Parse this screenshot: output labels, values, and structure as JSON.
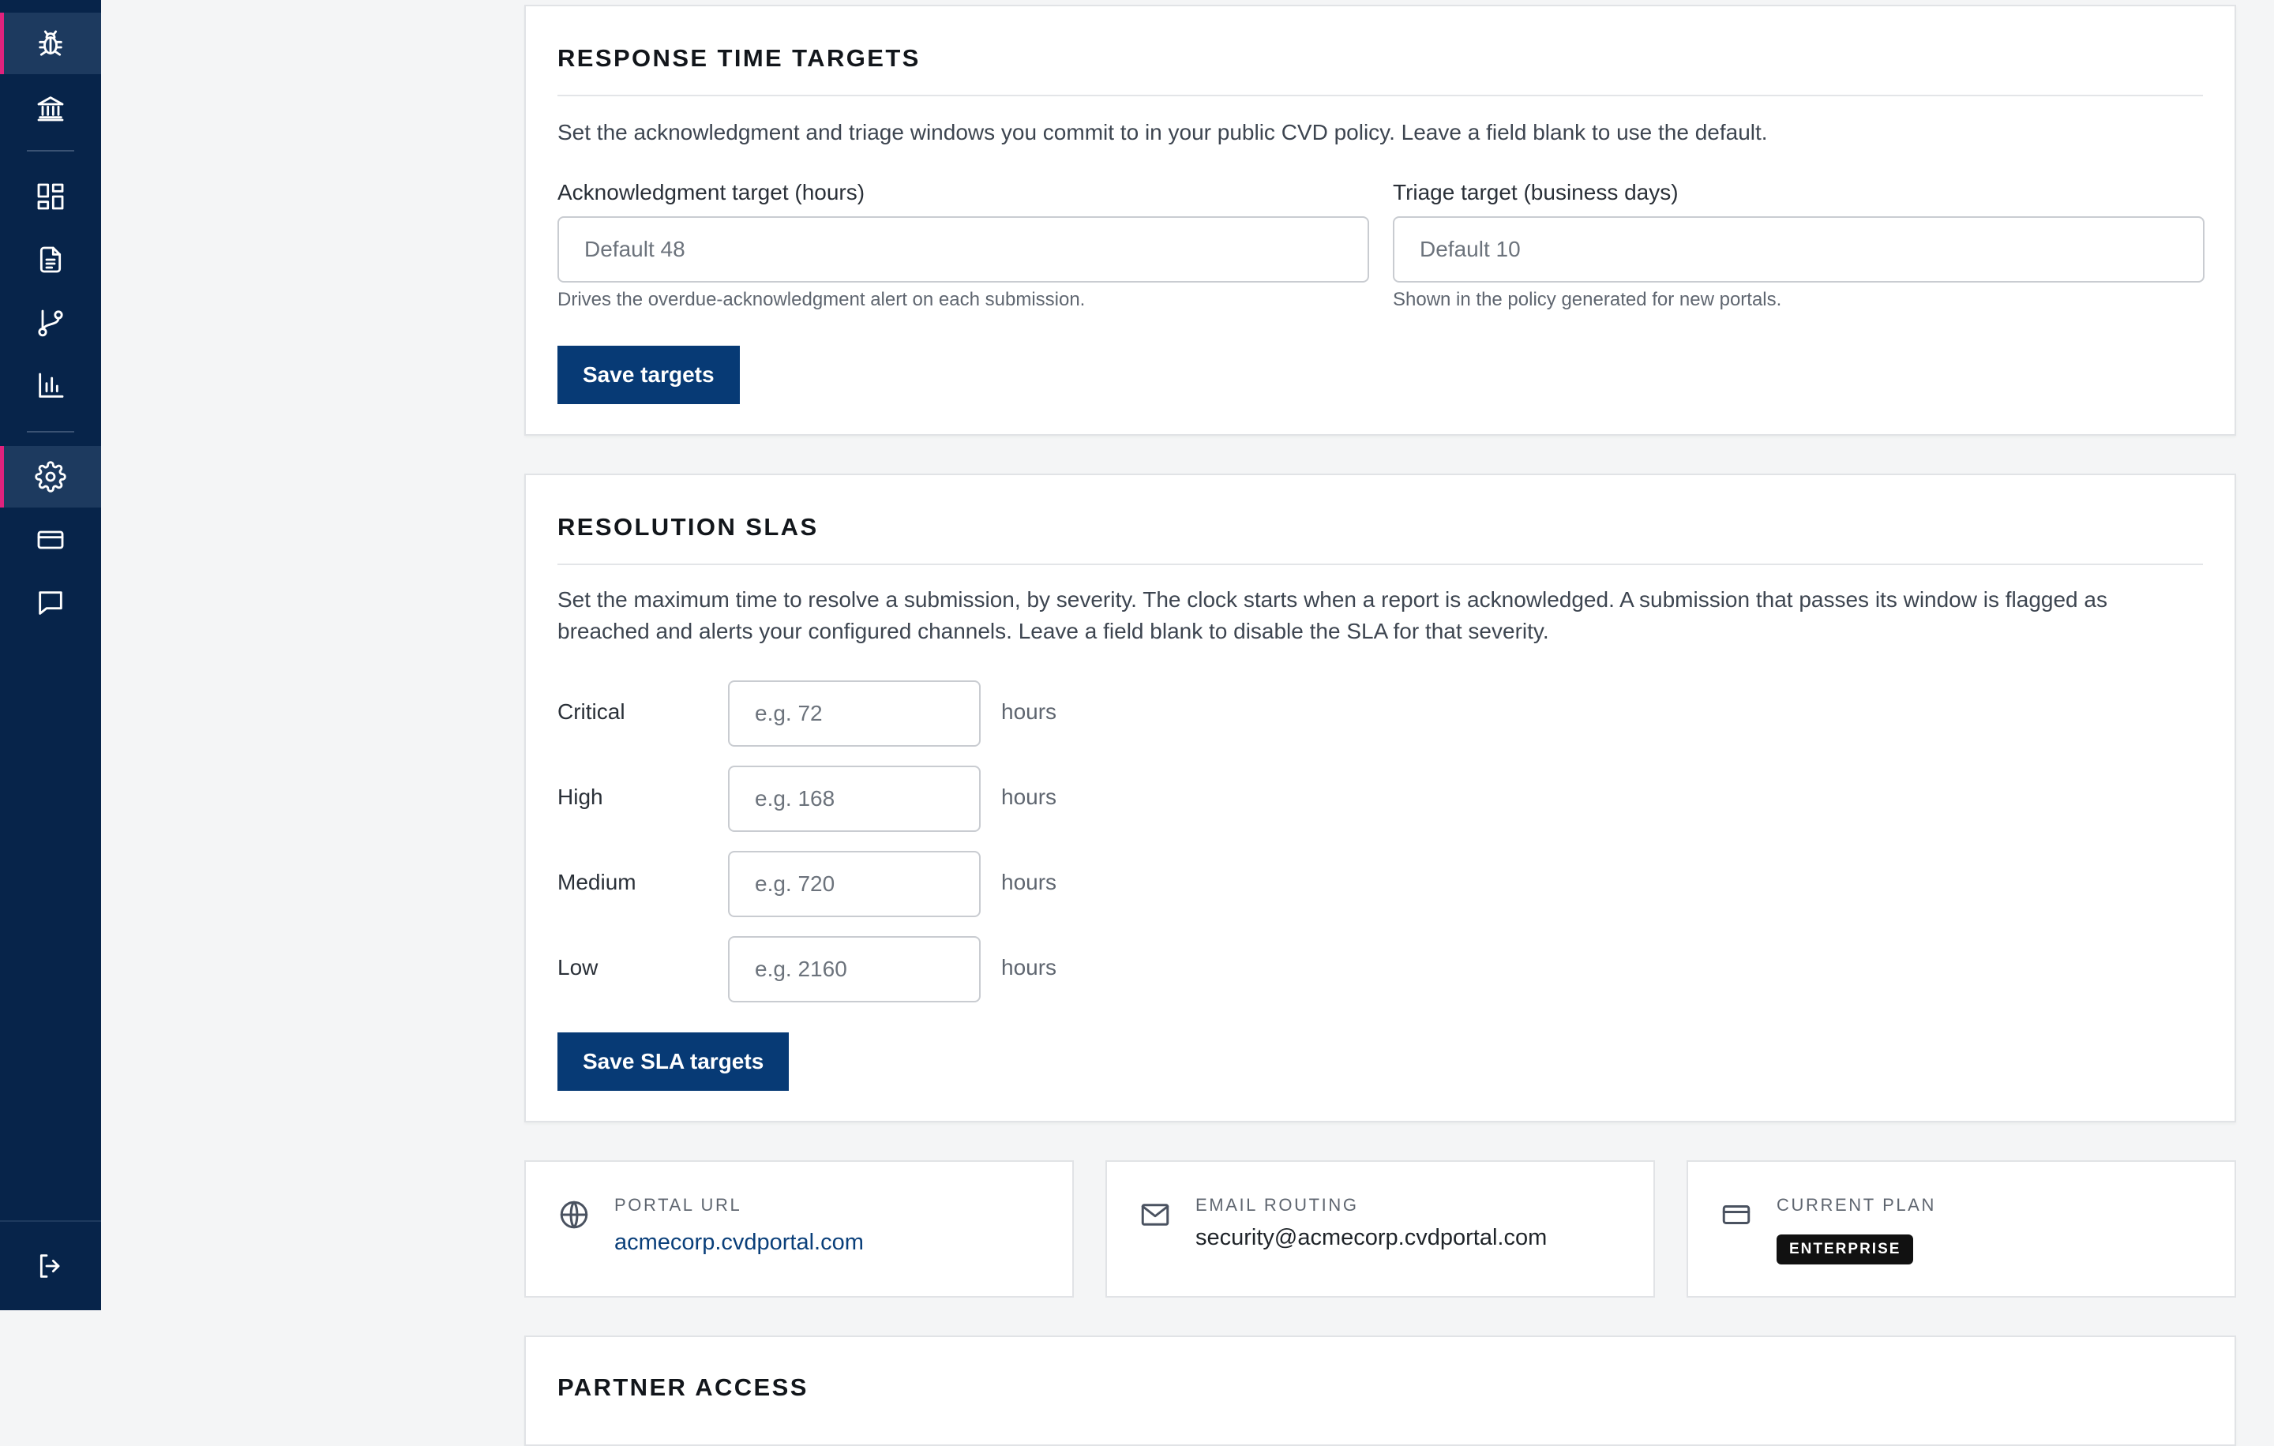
{
  "sidebar": {
    "items": [
      {
        "icon": "bug-icon",
        "active": true
      },
      {
        "icon": "bank-icon",
        "active": false
      },
      {
        "icon": "dashboard-icon",
        "active": false
      },
      {
        "icon": "document-icon",
        "active": false
      },
      {
        "icon": "git-branch-icon",
        "active": false
      },
      {
        "icon": "bar-chart-icon",
        "active": false
      },
      {
        "icon": "gear-icon",
        "active": true
      },
      {
        "icon": "credit-card-icon",
        "active": false
      },
      {
        "icon": "chat-icon",
        "active": false
      },
      {
        "icon": "logout-icon",
        "active": false
      }
    ]
  },
  "response_targets": {
    "title": "RESPONSE TIME TARGETS",
    "description": "Set the acknowledgment and triage windows you commit to in your public CVD policy. Leave a field blank to use the default.",
    "ack_label": "Acknowledgment target (hours)",
    "ack_placeholder": "Default 48",
    "ack_help": "Drives the overdue-acknowledgment alert on each submission.",
    "triage_label": "Triage target (business days)",
    "triage_placeholder": "Default 10",
    "triage_help": "Shown in the policy generated for new portals.",
    "save_label": "Save targets"
  },
  "resolution_slas": {
    "title": "RESOLUTION SLAS",
    "description": "Set the maximum time to resolve a submission, by severity. The clock starts when a report is acknowledged. A submission that passes its window is flagged as breached and alerts your configured channels. Leave a field blank to disable the SLA for that severity.",
    "rows": [
      {
        "severity": "Critical",
        "placeholder": "e.g. 72",
        "unit": "hours"
      },
      {
        "severity": "High",
        "placeholder": "e.g. 168",
        "unit": "hours"
      },
      {
        "severity": "Medium",
        "placeholder": "e.g. 720",
        "unit": "hours"
      },
      {
        "severity": "Low",
        "placeholder": "e.g. 2160",
        "unit": "hours"
      }
    ],
    "save_label": "Save SLA targets"
  },
  "info_cards": {
    "portal": {
      "label": "PORTAL URL",
      "value": "acmecorp.cvdportal.com",
      "icon": "globe-icon"
    },
    "email": {
      "label": "EMAIL ROUTING",
      "value": "security@acmecorp.cvdportal.com",
      "icon": "mail-icon"
    },
    "plan": {
      "label": "CURRENT PLAN",
      "value": "ENTERPRISE",
      "icon": "credit-card-icon"
    }
  },
  "partner_access": {
    "title": "PARTNER ACCESS"
  },
  "colors": {
    "sidebar": "#07244a",
    "accent": "#e0227d",
    "primary_button": "#073a75",
    "link": "#0a3f7a"
  }
}
